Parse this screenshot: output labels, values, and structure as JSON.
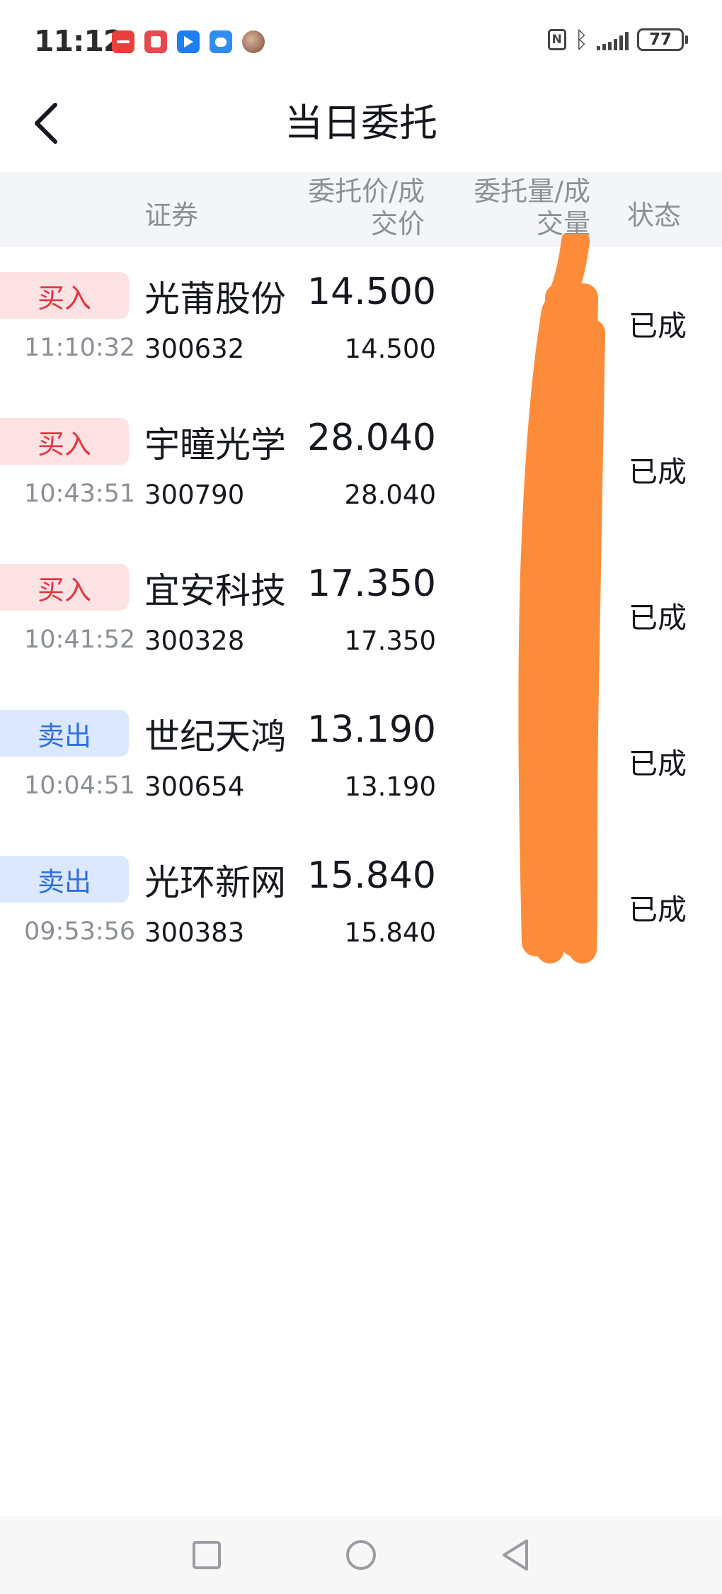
{
  "status_bar": {
    "time": "11:12",
    "battery": "77",
    "notification_icons": [
      "huawei-appgallery-icon",
      "red-app-icon",
      "blue-arrow-app-icon",
      "chat-bubble-icon",
      "avatar-icon"
    ],
    "system_icons": [
      "nfc-icon",
      "bluetooth-icon",
      "signal-icon",
      "battery-icon"
    ]
  },
  "header": {
    "title": "当日委托",
    "back_icon": "chevron-left-icon"
  },
  "columns": {
    "security": "证券",
    "price_line1": "委托价/成",
    "price_line2": "交价",
    "qty_line1": "委托量/成",
    "qty_line2": "交量",
    "status": "状态"
  },
  "orders": [
    {
      "side": "买入",
      "side_type": "buy",
      "time": "11:10:32",
      "name": "光莆股份",
      "code": "300632",
      "order_price": "14.500",
      "deal_price": "14.500",
      "status": "已成"
    },
    {
      "side": "买入",
      "side_type": "buy",
      "time": "10:43:51",
      "name": "宇瞳光学",
      "code": "300790",
      "order_price": "28.040",
      "deal_price": "28.040",
      "status": "已成"
    },
    {
      "side": "买入",
      "side_type": "buy",
      "time": "10:41:52",
      "name": "宜安科技",
      "code": "300328",
      "order_price": "17.350",
      "deal_price": "17.350",
      "status": "已成"
    },
    {
      "side": "卖出",
      "side_type": "sell",
      "time": "10:04:51",
      "name": "世纪天鸿",
      "code": "300654",
      "order_price": "13.190",
      "deal_price": "13.190",
      "status": "已成"
    },
    {
      "side": "卖出",
      "side_type": "sell",
      "time": "09:53:56",
      "name": "光环新网",
      "code": "300383",
      "order_price": "15.840",
      "deal_price": "15.840",
      "status": "已成"
    }
  ],
  "colors": {
    "buy_text": "#e2373f",
    "buy_bg": "#fde2e4",
    "sell_text": "#2f6fe0",
    "sell_bg": "#dce8fd",
    "redaction": "#fd8c3a"
  },
  "nav": {
    "icons": [
      "square-recents-icon",
      "circle-home-icon",
      "triangle-back-icon"
    ]
  }
}
